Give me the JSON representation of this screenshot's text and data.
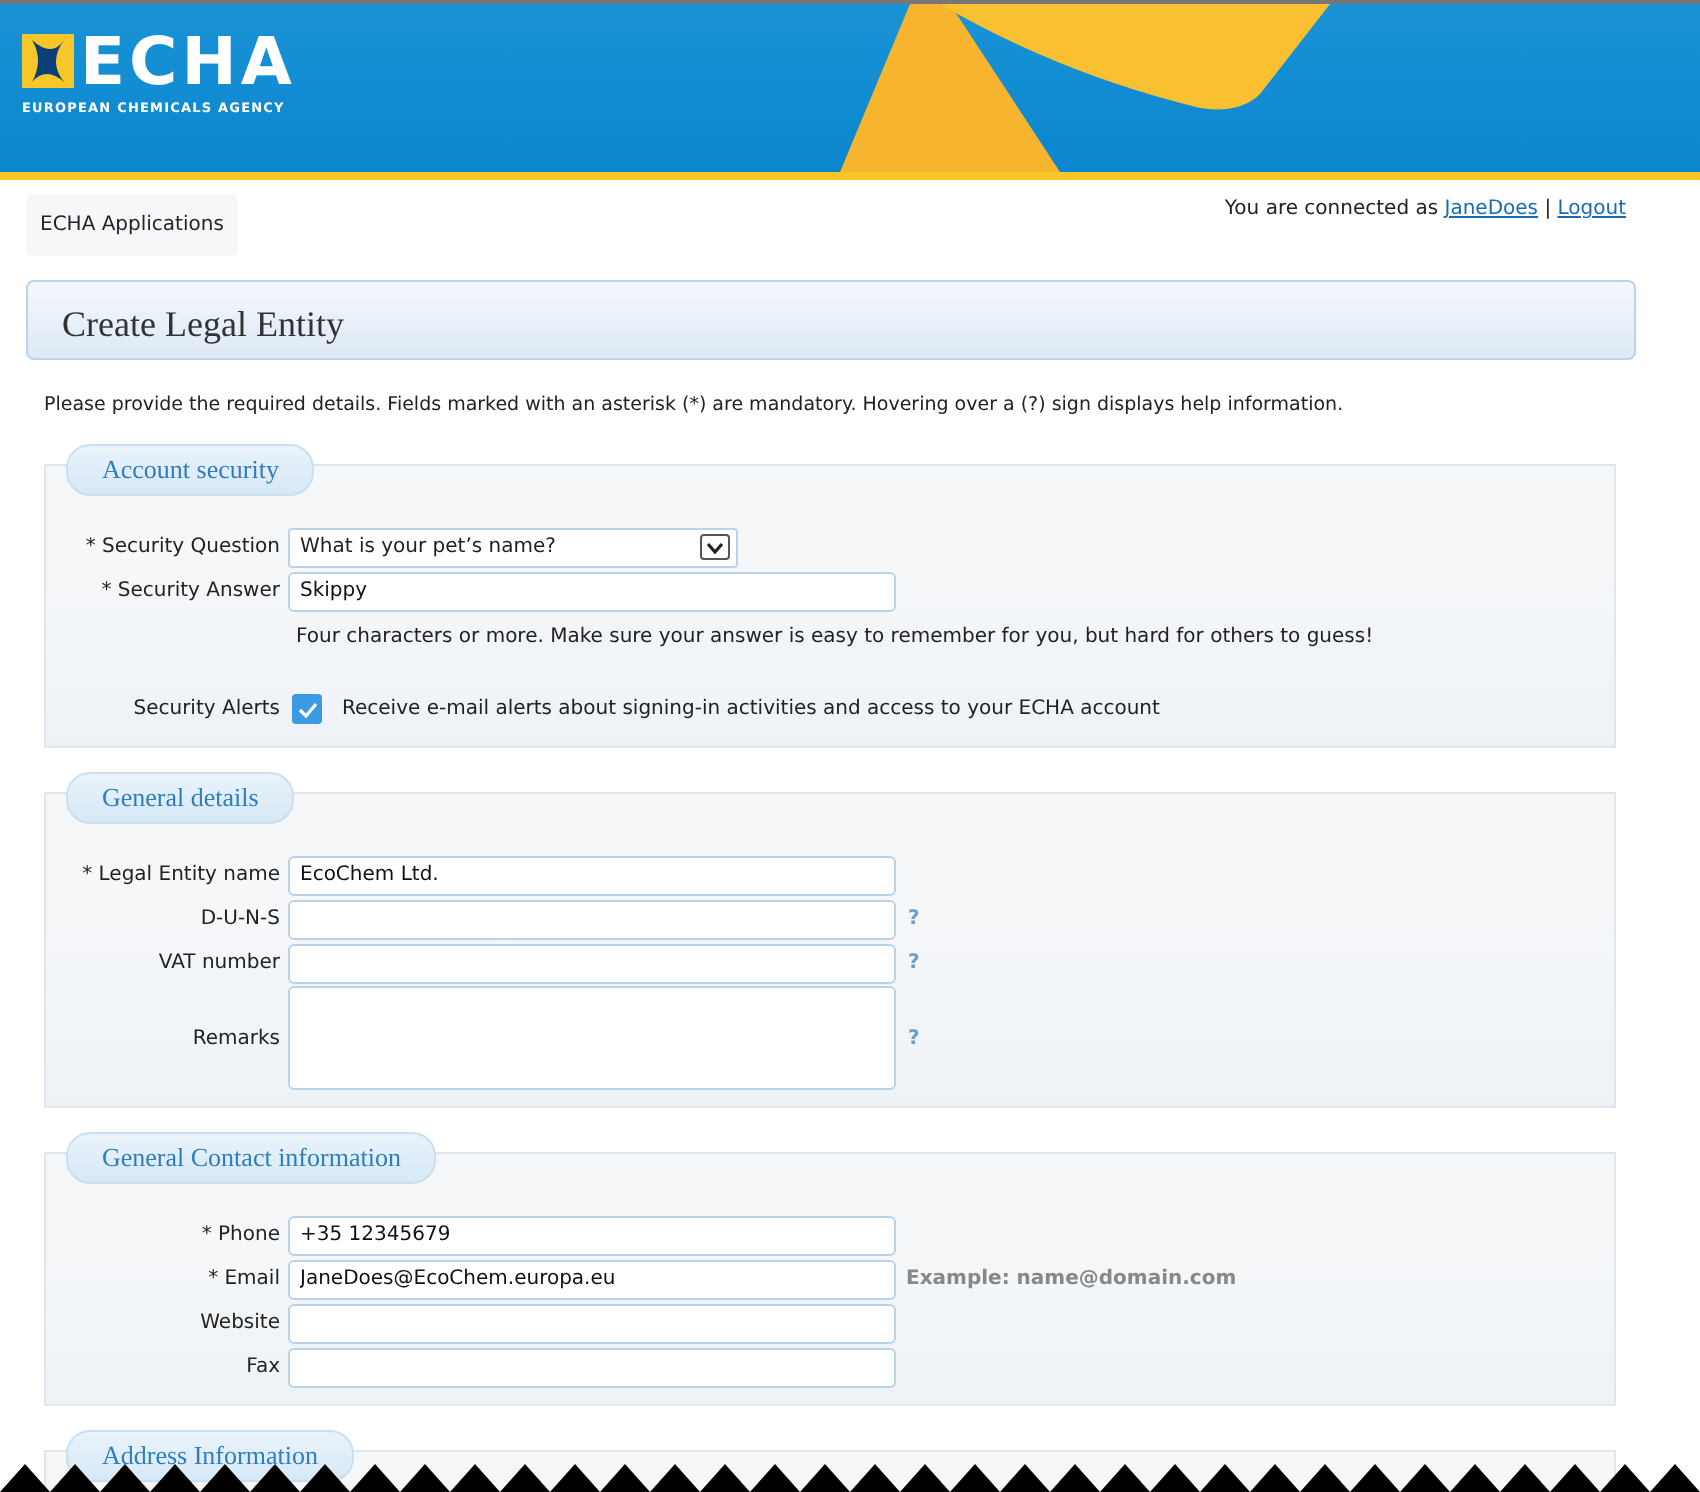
{
  "header": {
    "logo_text": "ECHA",
    "logo_subtitle": "EUROPEAN CHEMICALS AGENCY"
  },
  "nav": {
    "tab": "ECHA Applications",
    "connected_text": "You are connected as",
    "user": "JaneDoes",
    "separator": "|",
    "logout": "Logout"
  },
  "page_title": "Create Legal Entity",
  "intro": "Please provide the required details. Fields marked with an asterisk (*) are mandatory. Hovering over a (?) sign displays help information.",
  "sections": [
    {
      "title": "Account security",
      "fields": [
        {
          "kind": "select",
          "label": "* Security Question",
          "value": "What is your pet’s name?"
        },
        {
          "kind": "text",
          "label": "* Security Answer",
          "value": "Skippy",
          "note": "Four characters or more. Make sure your answer is easy to remember for you, but hard for others to guess!"
        },
        {
          "kind": "checkbox",
          "label": "Security Alerts",
          "checked": true,
          "text": "Receive e-mail alerts about signing-in activities and access to your ECHA account"
        }
      ]
    },
    {
      "title": "General details",
      "fields": [
        {
          "kind": "text",
          "label": "* Legal Entity name",
          "value": "EcoChem Ltd."
        },
        {
          "kind": "text",
          "label": "D-U-N-S",
          "help": "?"
        },
        {
          "kind": "text",
          "label": "VAT number",
          "help": "?"
        },
        {
          "kind": "textarea",
          "label": "Remarks",
          "help": "?"
        }
      ]
    },
    {
      "title": "General Contact information",
      "fields": [
        {
          "kind": "text",
          "label": "* Phone",
          "value": "+35 12345679"
        },
        {
          "kind": "text",
          "label": "* Email",
          "value": "JaneDoes@EcoChem.europa.eu",
          "example": "Example: name@domain.com"
        },
        {
          "kind": "text",
          "label": "Website"
        },
        {
          "kind": "text",
          "label": "Fax"
        }
      ]
    },
    {
      "title": "Address Information"
    }
  ]
}
